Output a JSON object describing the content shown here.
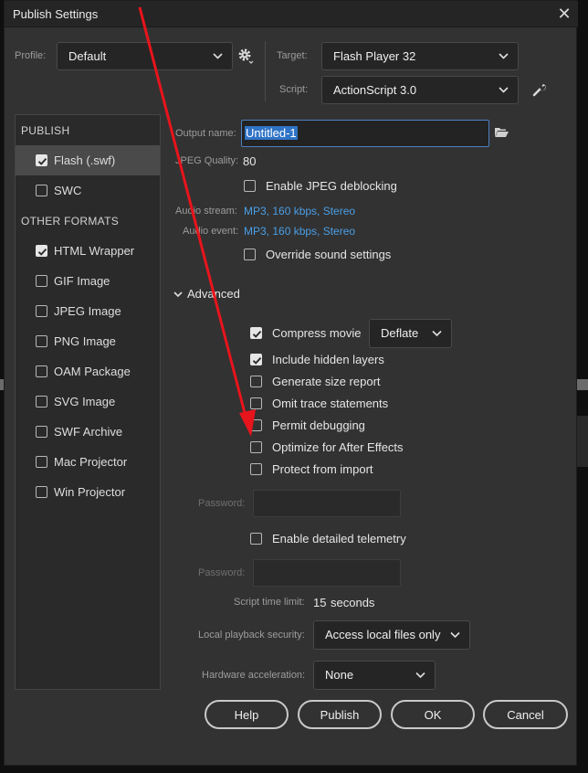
{
  "window": {
    "title": "Publish Settings",
    "close_glyph": "✕"
  },
  "profile": {
    "label": "Profile:",
    "value": "Default"
  },
  "target": {
    "label": "Target:",
    "value": "Flash Player 32"
  },
  "script": {
    "label": "Script:",
    "value": "ActionScript 3.0"
  },
  "sidebar": {
    "publish_header": "PUBLISH",
    "other_header": "OTHER FORMATS",
    "publish_items": [
      {
        "label": "Flash (.swf)",
        "checked": true,
        "selected": true
      },
      {
        "label": "SWC",
        "checked": false,
        "selected": false
      }
    ],
    "other_items": [
      {
        "label": "HTML Wrapper",
        "checked": true
      },
      {
        "label": "GIF Image",
        "checked": false
      },
      {
        "label": "JPEG Image",
        "checked": false
      },
      {
        "label": "PNG Image",
        "checked": false
      },
      {
        "label": "OAM Package",
        "checked": false
      },
      {
        "label": "SVG Image",
        "checked": false
      },
      {
        "label": "SWF Archive",
        "checked": false
      },
      {
        "label": "Mac Projector",
        "checked": false
      },
      {
        "label": "Win Projector",
        "checked": false
      }
    ]
  },
  "output": {
    "label": "Output name:",
    "value": "Untitled-1"
  },
  "jpeg": {
    "label": "JPEG Quality:",
    "value": "80",
    "deblocking_label": "Enable JPEG deblocking",
    "deblocking_checked": false
  },
  "audio": {
    "stream_label": "Audio stream:",
    "stream_value": "MP3, 160 kbps, Stereo",
    "event_label": "Audio event:",
    "event_value": "MP3, 160 kbps, Stereo",
    "override_label": "Override sound settings",
    "override_checked": false
  },
  "advanced": {
    "label": "Advanced",
    "compression": "Deflate",
    "options": [
      {
        "label": "Compress movie",
        "checked": true
      },
      {
        "label": "Include hidden layers",
        "checked": true
      },
      {
        "label": "Generate size report",
        "checked": false
      },
      {
        "label": "Omit trace statements",
        "checked": false
      },
      {
        "label": "Permit debugging",
        "checked": false
      },
      {
        "label": "Optimize for After Effects",
        "checked": false
      },
      {
        "label": "Protect from import",
        "checked": false
      }
    ],
    "password_label": "Password:",
    "telemetry_label": "Enable detailed telemetry",
    "telemetry_checked": false,
    "password2_label": "Password:",
    "script_time_label": "Script time limit:",
    "script_time_value": "15",
    "script_time_unit": "seconds",
    "local_playback_label": "Local playback security:",
    "local_playback_value": "Access local files only",
    "hardware_label": "Hardware acceleration:",
    "hardware_value": "None"
  },
  "buttons": {
    "help": "Help",
    "publish": "Publish",
    "ok": "OK",
    "cancel": "Cancel"
  },
  "colors": {
    "link": "#4a9ee6",
    "selection": "#2f73c6",
    "annotation_arrow": "#e8141c"
  }
}
